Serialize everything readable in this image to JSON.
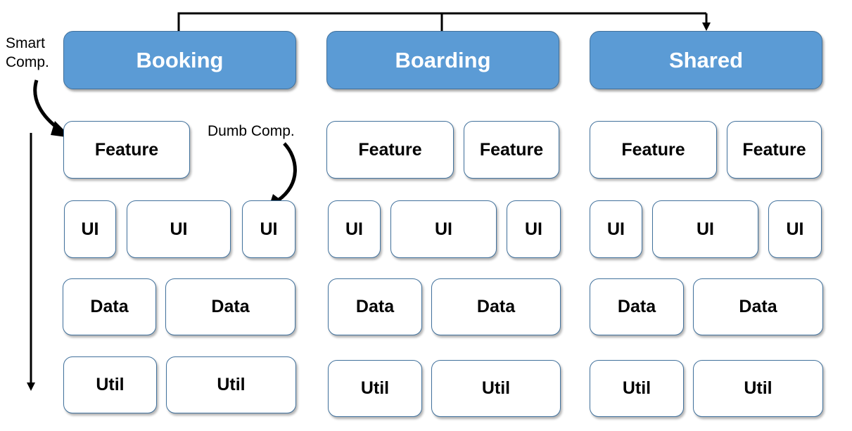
{
  "diagram": {
    "modules": [
      {
        "name": "Booking",
        "rows": {
          "feature": [
            "Feature"
          ],
          "ui": [
            "UI",
            "UI",
            "UI"
          ],
          "data": [
            "Data",
            "Data"
          ],
          "util": [
            "Util",
            "Util"
          ]
        }
      },
      {
        "name": "Boarding",
        "rows": {
          "feature": [
            "Feature",
            "Feature"
          ],
          "ui": [
            "UI",
            "UI",
            "UI"
          ],
          "data": [
            "Data",
            "Data"
          ],
          "util": [
            "Util",
            "Util"
          ]
        }
      },
      {
        "name": "Shared",
        "rows": {
          "feature": [
            "Feature",
            "Feature"
          ],
          "ui": [
            "UI",
            "UI",
            "UI"
          ],
          "data": [
            "Data",
            "Data"
          ],
          "util": [
            "Util",
            "Util"
          ]
        }
      }
    ],
    "annotations": {
      "smart": "Smart\nComp.",
      "dumb": "Dumb Comp."
    },
    "edges": [
      {
        "from": "Booking",
        "to": "Shared",
        "type": "dependency-arrow"
      },
      {
        "from": "Boarding",
        "to": "Shared",
        "type": "dependency-arrow"
      }
    ],
    "colors": {
      "module_fill": "#5b9bd5",
      "module_border": "#41719c",
      "box_fill": "#ffffff",
      "box_border": "#41719c",
      "line": "#000000"
    }
  }
}
